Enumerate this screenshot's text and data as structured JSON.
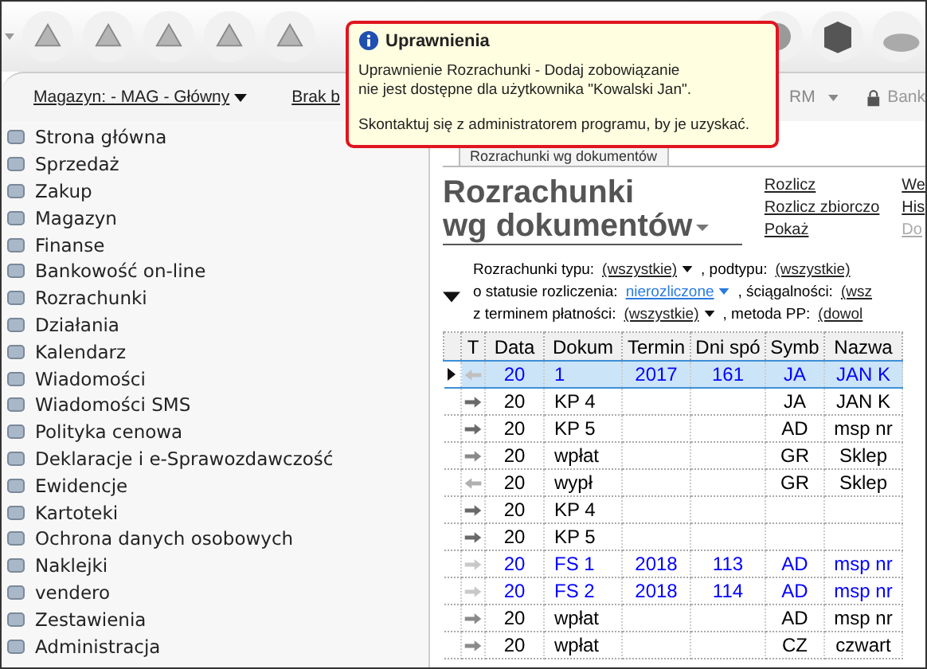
{
  "toolbar": {
    "left_bar": {
      "magazyn": "Magazyn: - MAG - Główny",
      "brak": "Brak b",
      "rm": "RM",
      "bank": "Bank"
    }
  },
  "tooltip": {
    "title": "Uprawnienia",
    "message": "Uprawnienie Rozrachunki - Dodaj zobowiązanie\nnie jest dostępne dla użytkownika \"Kowalski Jan\".",
    "hint": "Skontaktuj się z administratorem programu, by je uzyskać."
  },
  "sidebar": {
    "items": [
      {
        "label": "Strona główna"
      },
      {
        "label": "Sprzedaż"
      },
      {
        "label": "Zakup"
      },
      {
        "label": "Magazyn"
      },
      {
        "label": "Finanse"
      },
      {
        "label": "Bankowość on-line"
      },
      {
        "label": "Rozrachunki"
      },
      {
        "label": "Działania"
      },
      {
        "label": "Kalendarz"
      },
      {
        "label": "Wiadomości"
      },
      {
        "label": "Wiadomości SMS"
      },
      {
        "label": "Polityka cenowa"
      },
      {
        "label": "Deklaracje i e-Sprawozdawczość"
      },
      {
        "label": "Ewidencje"
      },
      {
        "label": "Kartoteki"
      },
      {
        "label": "Ochrona danych osobowych"
      },
      {
        "label": "Naklejki"
      },
      {
        "label": "vendero"
      },
      {
        "label": "Zestawienia"
      },
      {
        "label": "Administracja"
      }
    ]
  },
  "view": {
    "tab": "Rozrachunki wg dokumentów",
    "title_line1": "Rozrachunki",
    "title_line2": "wg dokumentów",
    "actions": [
      [
        "Rozlicz",
        "Rozlicz zbiorczo",
        "Pokaż"
      ],
      [
        "We",
        "His",
        "Do"
      ]
    ],
    "filters": [
      [
        {
          "text": "Rozrachunki typu:"
        },
        {
          "link": "(wszystkie)"
        },
        {
          "text": ", podtypu:"
        },
        {
          "link": "(wszystkie)"
        }
      ],
      [
        {
          "text": "o statusie rozliczenia:"
        },
        {
          "link": "nierozliczone",
          "accent": true
        },
        {
          "text": ", ściągalności:"
        },
        {
          "link": "(wsz"
        }
      ],
      [
        {
          "text": "z terminem płatności:"
        },
        {
          "link": "(wszystkie)"
        },
        {
          "text": ", metoda PP:"
        },
        {
          "link": "(dowol"
        }
      ]
    ]
  },
  "table": {
    "icon_column": "T",
    "columns": [
      "Data",
      "Dokum",
      "Termin",
      "Dni spó",
      "Symb",
      "Nazwa"
    ],
    "rows": [
      {
        "selected": true,
        "kind": "back",
        "color": "#0000ff",
        "cells": [
          "20",
          "1",
          "2017",
          "161",
          "JA",
          "JAN K"
        ]
      },
      {
        "selected": false,
        "kind": "right",
        "color": "#000000",
        "cells": [
          "20",
          "KP 4",
          "",
          "",
          "JA",
          "JAN K"
        ]
      },
      {
        "selected": false,
        "kind": "right",
        "color": "#000000",
        "cells": [
          "20",
          "KP 5",
          "",
          "",
          "AD",
          "msp nr"
        ]
      },
      {
        "selected": false,
        "kind": "deposit",
        "color": "#000000",
        "cells": [
          "20",
          "wpłat",
          "",
          "",
          "GR",
          "Sklep"
        ]
      },
      {
        "selected": false,
        "kind": "withdraw",
        "color": "#000000",
        "cells": [
          "20",
          "wypł",
          "",
          "",
          "GR",
          "Sklep"
        ]
      },
      {
        "selected": false,
        "kind": "right",
        "color": "#000000",
        "cells": [
          "20",
          "KP 4",
          "",
          "",
          "",
          ""
        ]
      },
      {
        "selected": false,
        "kind": "right",
        "color": "#000000",
        "cells": [
          "20",
          "KP 5",
          "",
          "",
          "",
          ""
        ]
      },
      {
        "selected": false,
        "kind": "pale",
        "color": "#0000ff",
        "cells": [
          "20",
          "FS 1",
          "2018",
          "113",
          "AD",
          "msp nr"
        ]
      },
      {
        "selected": false,
        "kind": "pale",
        "color": "#0000ff",
        "cells": [
          "20",
          "FS 2",
          "2018",
          "114",
          "AD",
          "msp nr"
        ]
      },
      {
        "selected": false,
        "kind": "deposit",
        "color": "#000000",
        "cells": [
          "20",
          "wpłat",
          "",
          "",
          "AD",
          "msp nr"
        ]
      },
      {
        "selected": false,
        "kind": "deposit",
        "color": "#000000",
        "cells": [
          "20",
          "wpłat",
          "",
          "",
          "CZ",
          "czwart"
        ]
      }
    ]
  }
}
